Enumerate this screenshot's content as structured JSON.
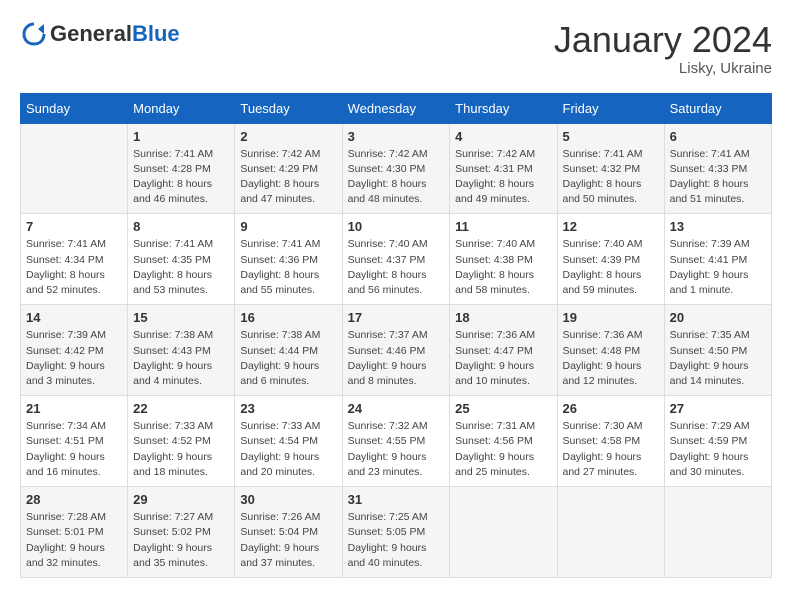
{
  "logo": {
    "general": "General",
    "blue": "Blue"
  },
  "title": "January 2024",
  "location": "Lisky, Ukraine",
  "weekdays": [
    "Sunday",
    "Monday",
    "Tuesday",
    "Wednesday",
    "Thursday",
    "Friday",
    "Saturday"
  ],
  "weeks": [
    [
      {
        "day": "",
        "sunrise": "",
        "sunset": "",
        "daylight": ""
      },
      {
        "day": "1",
        "sunrise": "7:41 AM",
        "sunset": "4:28 PM",
        "daylight": "8 hours and 46 minutes."
      },
      {
        "day": "2",
        "sunrise": "7:42 AM",
        "sunset": "4:29 PM",
        "daylight": "8 hours and 47 minutes."
      },
      {
        "day": "3",
        "sunrise": "7:42 AM",
        "sunset": "4:30 PM",
        "daylight": "8 hours and 48 minutes."
      },
      {
        "day": "4",
        "sunrise": "7:42 AM",
        "sunset": "4:31 PM",
        "daylight": "8 hours and 49 minutes."
      },
      {
        "day": "5",
        "sunrise": "7:41 AM",
        "sunset": "4:32 PM",
        "daylight": "8 hours and 50 minutes."
      },
      {
        "day": "6",
        "sunrise": "7:41 AM",
        "sunset": "4:33 PM",
        "daylight": "8 hours and 51 minutes."
      }
    ],
    [
      {
        "day": "7",
        "sunrise": "7:41 AM",
        "sunset": "4:34 PM",
        "daylight": "8 hours and 52 minutes."
      },
      {
        "day": "8",
        "sunrise": "7:41 AM",
        "sunset": "4:35 PM",
        "daylight": "8 hours and 53 minutes."
      },
      {
        "day": "9",
        "sunrise": "7:41 AM",
        "sunset": "4:36 PM",
        "daylight": "8 hours and 55 minutes."
      },
      {
        "day": "10",
        "sunrise": "7:40 AM",
        "sunset": "4:37 PM",
        "daylight": "8 hours and 56 minutes."
      },
      {
        "day": "11",
        "sunrise": "7:40 AM",
        "sunset": "4:38 PM",
        "daylight": "8 hours and 58 minutes."
      },
      {
        "day": "12",
        "sunrise": "7:40 AM",
        "sunset": "4:39 PM",
        "daylight": "8 hours and 59 minutes."
      },
      {
        "day": "13",
        "sunrise": "7:39 AM",
        "sunset": "4:41 PM",
        "daylight": "9 hours and 1 minute."
      }
    ],
    [
      {
        "day": "14",
        "sunrise": "7:39 AM",
        "sunset": "4:42 PM",
        "daylight": "9 hours and 3 minutes."
      },
      {
        "day": "15",
        "sunrise": "7:38 AM",
        "sunset": "4:43 PM",
        "daylight": "9 hours and 4 minutes."
      },
      {
        "day": "16",
        "sunrise": "7:38 AM",
        "sunset": "4:44 PM",
        "daylight": "9 hours and 6 minutes."
      },
      {
        "day": "17",
        "sunrise": "7:37 AM",
        "sunset": "4:46 PM",
        "daylight": "9 hours and 8 minutes."
      },
      {
        "day": "18",
        "sunrise": "7:36 AM",
        "sunset": "4:47 PM",
        "daylight": "9 hours and 10 minutes."
      },
      {
        "day": "19",
        "sunrise": "7:36 AM",
        "sunset": "4:48 PM",
        "daylight": "9 hours and 12 minutes."
      },
      {
        "day": "20",
        "sunrise": "7:35 AM",
        "sunset": "4:50 PM",
        "daylight": "9 hours and 14 minutes."
      }
    ],
    [
      {
        "day": "21",
        "sunrise": "7:34 AM",
        "sunset": "4:51 PM",
        "daylight": "9 hours and 16 minutes."
      },
      {
        "day": "22",
        "sunrise": "7:33 AM",
        "sunset": "4:52 PM",
        "daylight": "9 hours and 18 minutes."
      },
      {
        "day": "23",
        "sunrise": "7:33 AM",
        "sunset": "4:54 PM",
        "daylight": "9 hours and 20 minutes."
      },
      {
        "day": "24",
        "sunrise": "7:32 AM",
        "sunset": "4:55 PM",
        "daylight": "9 hours and 23 minutes."
      },
      {
        "day": "25",
        "sunrise": "7:31 AM",
        "sunset": "4:56 PM",
        "daylight": "9 hours and 25 minutes."
      },
      {
        "day": "26",
        "sunrise": "7:30 AM",
        "sunset": "4:58 PM",
        "daylight": "9 hours and 27 minutes."
      },
      {
        "day": "27",
        "sunrise": "7:29 AM",
        "sunset": "4:59 PM",
        "daylight": "9 hours and 30 minutes."
      }
    ],
    [
      {
        "day": "28",
        "sunrise": "7:28 AM",
        "sunset": "5:01 PM",
        "daylight": "9 hours and 32 minutes."
      },
      {
        "day": "29",
        "sunrise": "7:27 AM",
        "sunset": "5:02 PM",
        "daylight": "9 hours and 35 minutes."
      },
      {
        "day": "30",
        "sunrise": "7:26 AM",
        "sunset": "5:04 PM",
        "daylight": "9 hours and 37 minutes."
      },
      {
        "day": "31",
        "sunrise": "7:25 AM",
        "sunset": "5:05 PM",
        "daylight": "9 hours and 40 minutes."
      },
      {
        "day": "",
        "sunrise": "",
        "sunset": "",
        "daylight": ""
      },
      {
        "day": "",
        "sunrise": "",
        "sunset": "",
        "daylight": ""
      },
      {
        "day": "",
        "sunrise": "",
        "sunset": "",
        "daylight": ""
      }
    ]
  ],
  "labels": {
    "sunrise_prefix": "Sunrise: ",
    "sunset_prefix": "Sunset: ",
    "daylight_prefix": "Daylight: "
  }
}
